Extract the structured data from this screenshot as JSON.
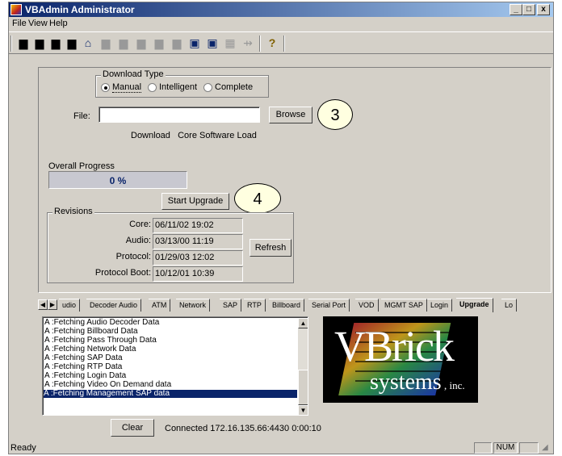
{
  "window": {
    "title": "VBAdmin Administrator",
    "min": "_",
    "max": "□",
    "close": "x"
  },
  "menu": [
    "File",
    "View",
    "Help"
  ],
  "toolbar": {
    "icons": [
      "download-icon",
      "upload-icon",
      "download-icon",
      "upload-icon",
      "home-icon",
      "disabled-icon",
      "disabled-icon",
      "disabled-icon",
      "disabled-icon",
      "disabled-icon",
      "device-icon",
      "device-icon",
      "grid-icon",
      "antenna-icon",
      "help-icon"
    ]
  },
  "download": {
    "group_label": "Download Type",
    "options": [
      "Manual",
      "Intelligent",
      "Complete"
    ],
    "selected": "Manual",
    "file_label": "File:",
    "file_value": "",
    "browse_label": "Browse",
    "load_text": "Download   Core Software Load"
  },
  "progress": {
    "label": "Overall Progress",
    "percent_text": "0 %",
    "value": 0
  },
  "start_upgrade_label": "Start Upgrade",
  "callouts": [
    "3",
    "4"
  ],
  "revisions": {
    "group_label": "Revisions",
    "rows": [
      {
        "label": "Core:",
        "value": "06/11/02 19:02"
      },
      {
        "label": "Audio:",
        "value": "03/13/00 11:19"
      },
      {
        "label": "Protocol:",
        "value": "01/29/03 12:02"
      },
      {
        "label": "Protocol Boot:",
        "value": "10/12/01 10:39"
      }
    ],
    "refresh_label": "Refresh"
  },
  "tabs": [
    "udio",
    "Decoder Audio",
    "ATM",
    "Network",
    "SAP",
    "RTP",
    "Billboard",
    "Serial Port",
    "VOD",
    "MGMT SAP",
    "Login",
    "Upgrade",
    "Lo"
  ],
  "active_tab": "Upgrade",
  "log": [
    "A :Fetching Audio Decoder Data",
    "A :Fetching Billboard Data",
    "A :Fetching Pass Through Data",
    "A :Fetching Network Data",
    "A :Fetching SAP Data",
    "A :Fetching RTP Data",
    "A :Fetching Login Data",
    "A :Fetching Video On Demand data",
    "A :Fetching Management SAP data"
  ],
  "log_selected_index": 8,
  "clear_label": "Clear",
  "connection_text": "Connected 172.16.135.66:4430 0:00:10",
  "logo": {
    "line1": "VBrick",
    "line2": "systems",
    "line3": ", inc."
  },
  "status": {
    "text": "Ready",
    "num": "NUM"
  }
}
